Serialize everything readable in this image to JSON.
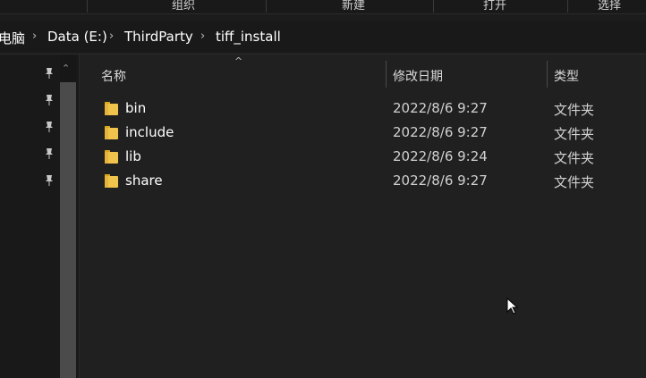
{
  "ribbon": {
    "groups": [
      "组织",
      "新建",
      "打开",
      "选择"
    ]
  },
  "breadcrumb": {
    "items": [
      "电脑",
      "Data (E:)",
      "ThirdParty",
      "tiff_install"
    ]
  },
  "columns": {
    "name": "名称",
    "date": "修改日期",
    "type": "类型"
  },
  "files": [
    {
      "name": "bin",
      "date": "2022/8/6 9:27",
      "type": "文件夹"
    },
    {
      "name": "include",
      "date": "2022/8/6 9:27",
      "type": "文件夹"
    },
    {
      "name": "lib",
      "date": "2022/8/6 9:24",
      "type": "文件夹"
    },
    {
      "name": "share",
      "date": "2022/8/6 9:27",
      "type": "文件夹"
    }
  ],
  "icons": {
    "folder": "folder-icon",
    "pin": "pin-icon",
    "chevron": "chevron-right-icon"
  },
  "colors": {
    "background": "#202020",
    "folder": "#f0c44c",
    "text": "#ffffff"
  }
}
